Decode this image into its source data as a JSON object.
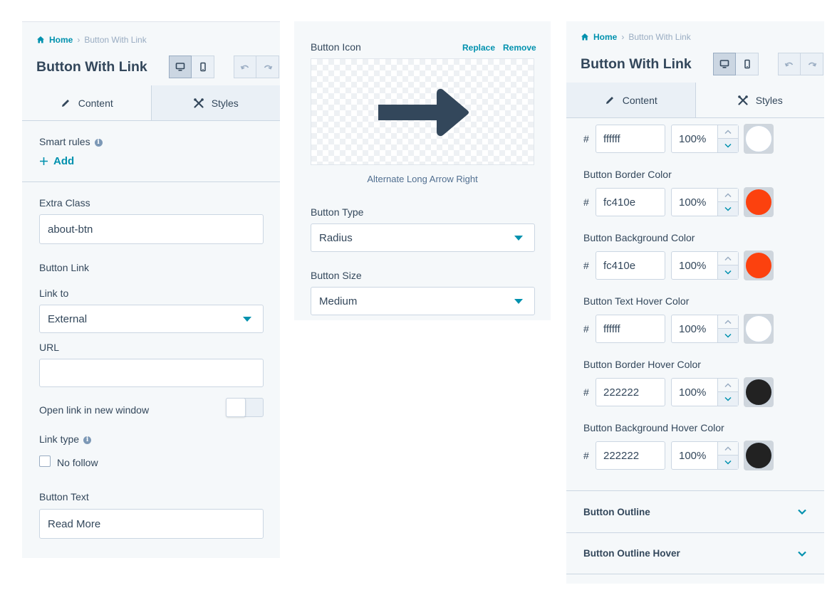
{
  "panel_left": {
    "breadcrumb": {
      "home": "Home",
      "current": "Button With Link"
    },
    "title": "Button With Link",
    "tabs": {
      "content": "Content",
      "styles": "Styles",
      "active": "content"
    },
    "smart_rules": {
      "label": "Smart rules",
      "add": "Add"
    },
    "extra_class": {
      "label": "Extra Class",
      "value": "about-btn"
    },
    "button_link": {
      "heading": "Button Link",
      "link_to_label": "Link to",
      "link_to_value": "External"
    },
    "url": {
      "label": "URL",
      "value": ""
    },
    "open_new_window": {
      "label": "Open link in new window",
      "enabled": false
    },
    "link_type": {
      "label": "Link type",
      "no_follow": "No follow",
      "no_follow_checked": false
    },
    "button_text": {
      "label": "Button Text",
      "value": "Read More"
    }
  },
  "panel_middle": {
    "button_icon": {
      "label": "Button Icon",
      "replace": "Replace",
      "remove": "Remove",
      "icon": "arrow-right-icon",
      "caption": "Alternate Long Arrow Right",
      "icon_color": "#33475b"
    },
    "button_type": {
      "label": "Button Type",
      "value": "Radius"
    },
    "button_size": {
      "label": "Button Size",
      "value": "Medium"
    }
  },
  "panel_right": {
    "breadcrumb": {
      "home": "Home",
      "current": "Button With Link"
    },
    "title": "Button With Link",
    "tabs": {
      "content": "Content",
      "styles": "Styles",
      "active": "styles"
    },
    "colors": [
      {
        "label": "",
        "hex": "ffffff",
        "opacity": "100%",
        "swatch": "#ffffff"
      },
      {
        "label": "Button Border Color",
        "hex": "fc410e",
        "opacity": "100%",
        "swatch": "#fc410e"
      },
      {
        "label": "Button Background Color",
        "hex": "fc410e",
        "opacity": "100%",
        "swatch": "#fc410e"
      },
      {
        "label": "Button Text Hover Color",
        "hex": "ffffff",
        "opacity": "100%",
        "swatch": "#ffffff"
      },
      {
        "label": "Button Border Hover Color",
        "hex": "222222",
        "opacity": "100%",
        "swatch": "#222222"
      },
      {
        "label": "Button Background Hover Color",
        "hex": "222222",
        "opacity": "100%",
        "swatch": "#222222"
      }
    ],
    "hash_symbol": "#",
    "sections": [
      "Button Outline",
      "Button Outline Hover"
    ]
  },
  "theme": {
    "accent": "#0091ae",
    "text": "#33475b",
    "panel_bg": "#f5f8fa",
    "border": "#cbd6e2"
  }
}
